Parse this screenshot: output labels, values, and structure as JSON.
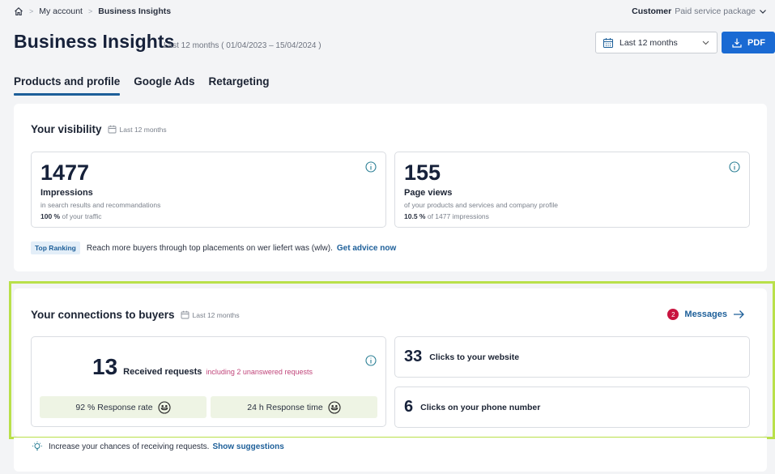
{
  "breadcrumb": {
    "home_icon": "home-icon",
    "items": [
      "My account",
      "Business Insights"
    ]
  },
  "account": {
    "label": "Customer",
    "package": "Paid service package"
  },
  "header": {
    "title": "Business Insights",
    "subtitle": "Last 12 months ( 01/04/2023 – 15/04/2024 )",
    "period_select": {
      "value": "Last 12 months",
      "icon": "calendar-icon"
    },
    "pdf_button": {
      "label": "PDF",
      "icon": "download-icon"
    }
  },
  "tabs": [
    {
      "label": "Products and profile",
      "active": true
    },
    {
      "label": "Google Ads",
      "active": false
    },
    {
      "label": "Retargeting",
      "active": false
    }
  ],
  "visibility": {
    "title": "Your visibility",
    "period": "Last 12 months",
    "metrics": [
      {
        "value": "1477",
        "label": "Impressions",
        "description": "in search results and recommandations",
        "share_value": "100 %",
        "share_text": "of your traffic"
      },
      {
        "value": "155",
        "label": "Page views",
        "description": "of your products and services and company profile",
        "share_value": "10.5 %",
        "share_text": "of 1477 impressions"
      }
    ],
    "promo": {
      "badge": "Top Ranking",
      "text": "Reach more buyers through top placements on  wer liefert was (wlw).",
      "link": "Get advice now"
    }
  },
  "connections": {
    "title": "Your connections to buyers",
    "period": "Last 12 months",
    "messages": {
      "count": "2",
      "label": "Messages"
    },
    "requests": {
      "value": "13",
      "label": "Received requests",
      "note": "including 2 unanswered requests"
    },
    "response_rate": "92 % Response rate",
    "response_time": "24 h Response time",
    "clicks": [
      {
        "value": "33",
        "label": "Clicks to your website"
      },
      {
        "value": "6",
        "label": "Clicks on your phone number"
      }
    ]
  },
  "tip": {
    "text": "Increase your chances of receiving requests.",
    "link": "Show suggestions"
  },
  "colors": {
    "primary": "#1a6ad3",
    "link": "#1d5f99",
    "highlight_outline": "#b9e04a",
    "alert": "#c8143f",
    "unanswered": "#c0457a"
  }
}
